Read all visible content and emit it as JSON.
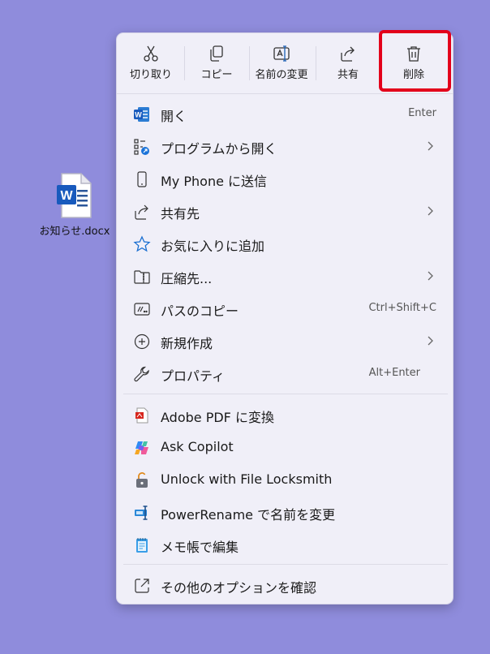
{
  "desktop": {
    "file_name": "お知らせ.docx"
  },
  "toolbar": {
    "cut": "切り取り",
    "copy": "コピー",
    "rename": "名前の変更",
    "share": "共有",
    "delete": "削除"
  },
  "menu": {
    "open": {
      "label": "開く",
      "shortcut": "Enter"
    },
    "open_with": {
      "label": "プログラムから開く"
    },
    "send_phone": {
      "label": "My Phone に送信"
    },
    "share_to": {
      "label": "共有先"
    },
    "favorite": {
      "label": "お気に入りに追加"
    },
    "compress": {
      "label": "圧縮先..."
    },
    "copy_path": {
      "label": "パスのコピー",
      "shortcut": "Ctrl+Shift+C"
    },
    "new": {
      "label": "新規作成"
    },
    "properties": {
      "label": "プロパティ",
      "shortcut": "Alt+Enter"
    },
    "adobe_pdf": {
      "label": "Adobe PDF に変換"
    },
    "ask_copilot": {
      "label": "Ask Copilot"
    },
    "unlock": {
      "label": "Unlock with File Locksmith"
    },
    "powerrename": {
      "label": "PowerRename で名前を変更"
    },
    "notepad": {
      "label": "メモ帳で編集"
    },
    "more_options": {
      "label": "その他のオプションを確認"
    }
  },
  "colors": {
    "desktop": "#8f8cdc",
    "menu_bg": "#f0eff8",
    "highlight": "#e3001b",
    "word_blue": "#2b579a"
  }
}
